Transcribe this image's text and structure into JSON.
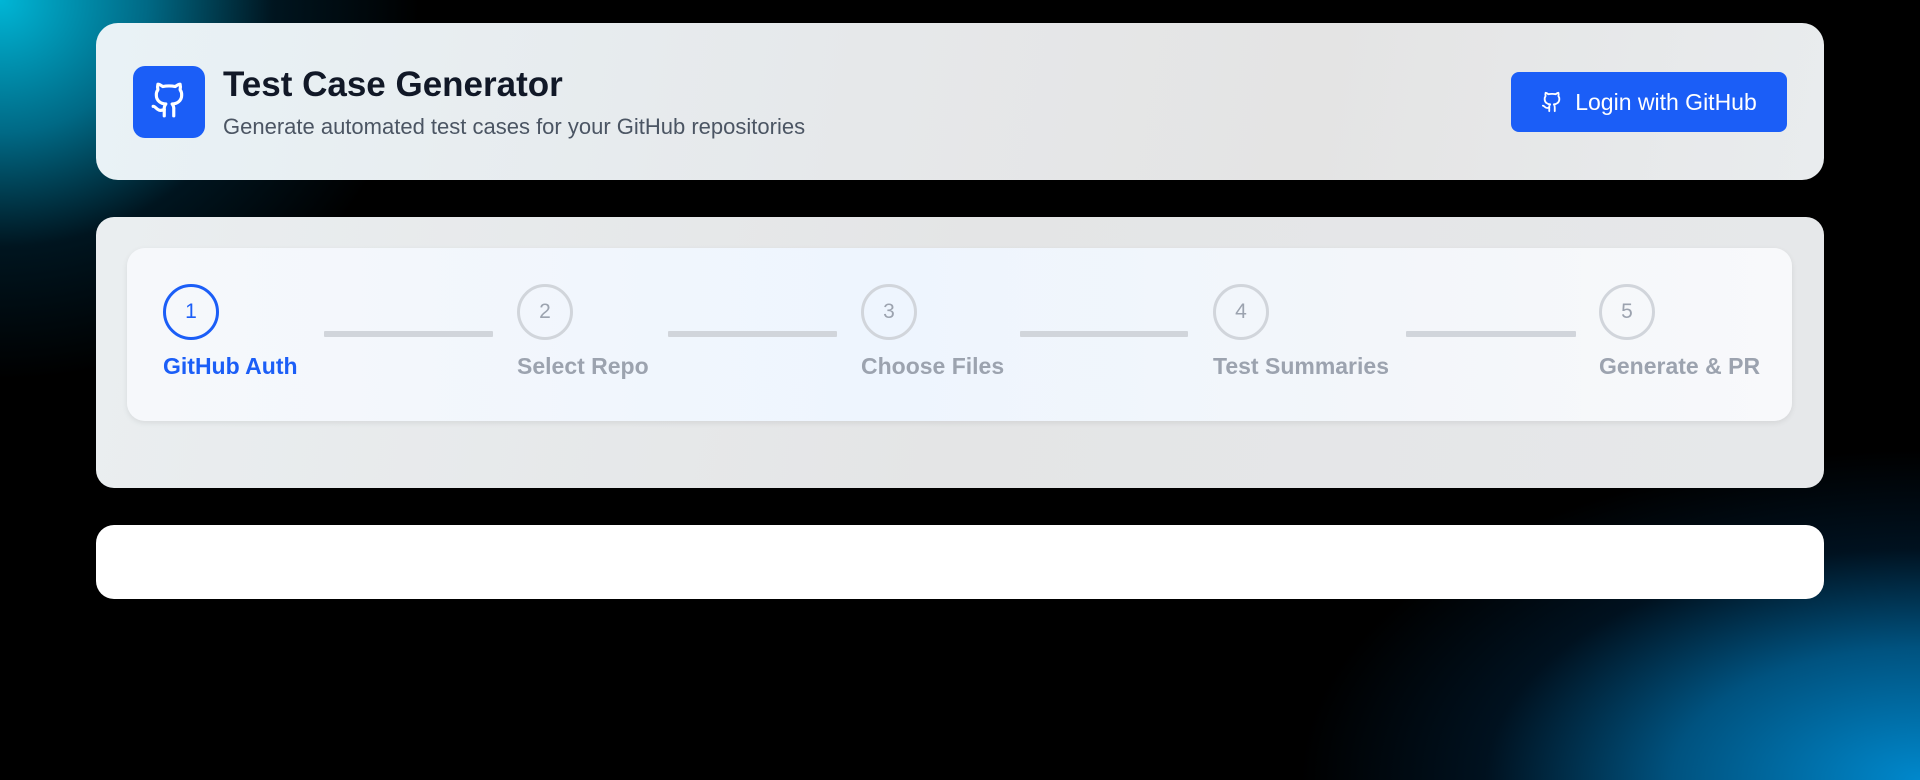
{
  "header": {
    "logo_icon": "github-icon",
    "title": "Test Case Generator",
    "subtitle": "Generate automated test cases for your GitHub repositories",
    "login_button": {
      "label": "Login with GitHub",
      "icon": "github-icon"
    }
  },
  "stepper": {
    "active_step": 1,
    "steps": [
      {
        "number": "1",
        "label": "GitHub Auth"
      },
      {
        "number": "2",
        "label": "Select Repo"
      },
      {
        "number": "3",
        "label": "Choose Files"
      },
      {
        "number": "4",
        "label": "Test Summaries"
      },
      {
        "number": "5",
        "label": "Generate & PR"
      }
    ]
  },
  "colors": {
    "accent": "#1b5ef7",
    "title_text": "#111827",
    "subtitle_text": "#4b5563",
    "inactive_step": "#9ca3af",
    "connector": "#d1d5db"
  }
}
